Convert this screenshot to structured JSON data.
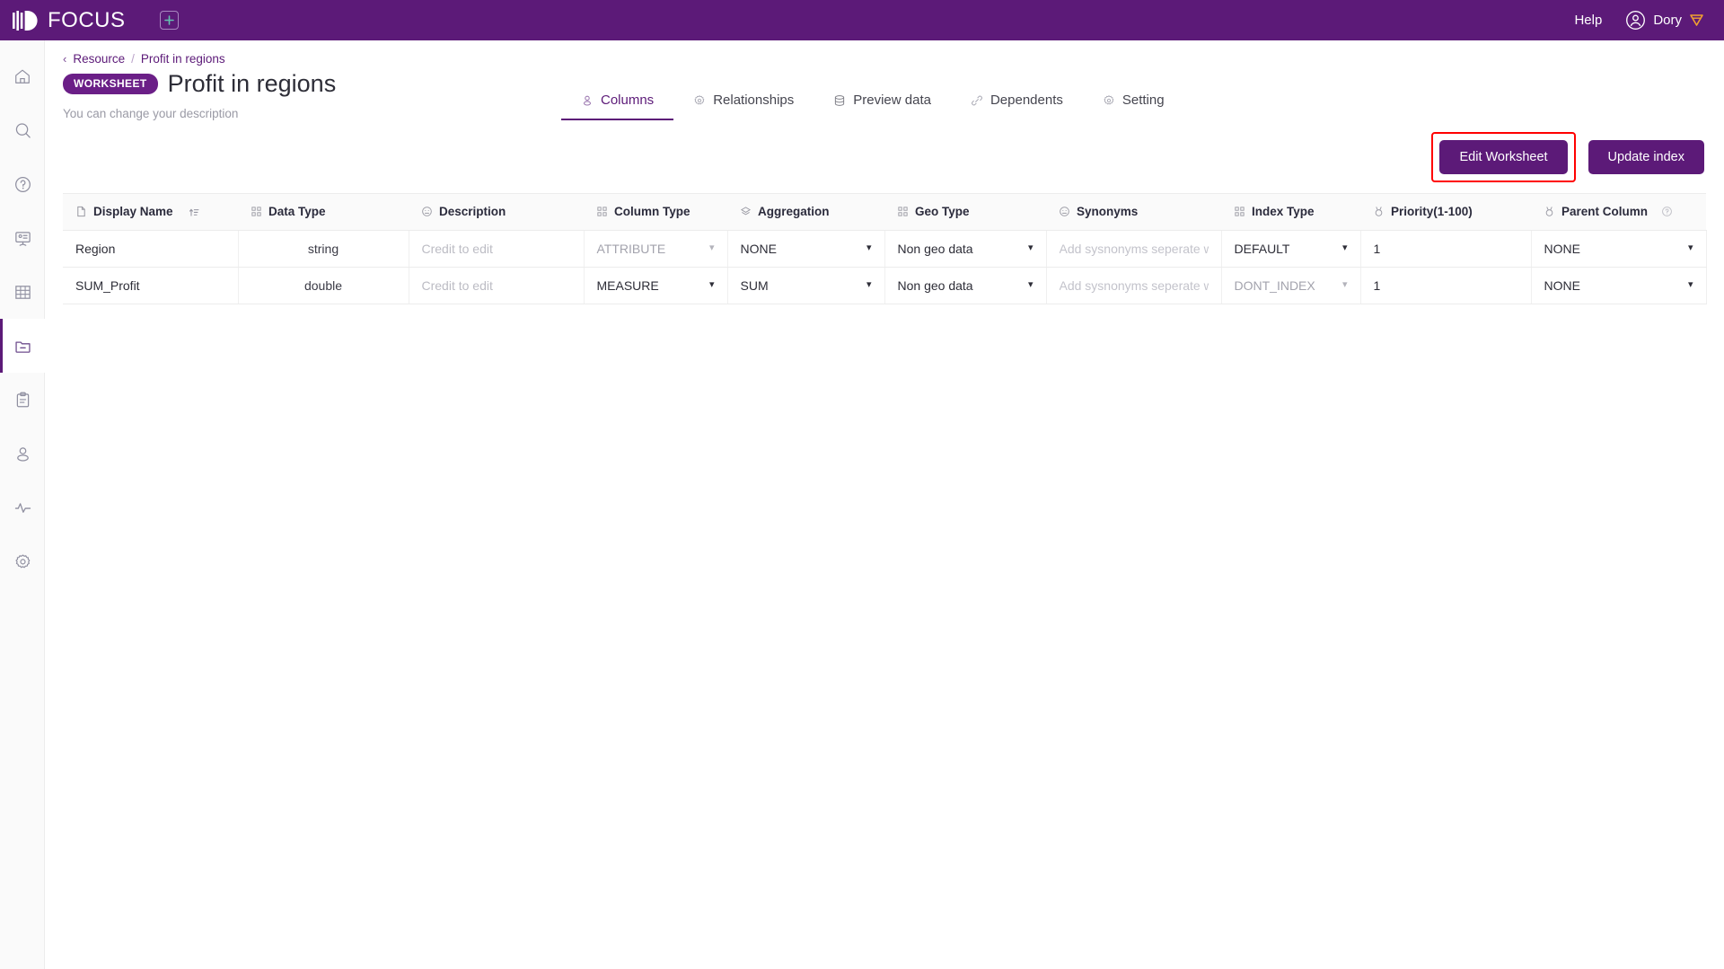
{
  "topbar": {
    "brand": "FOCUS",
    "add_tab_icon": "plus-square-icon",
    "help": "Help",
    "user_name": "Dory",
    "user_icon": "user-circle-icon",
    "badge_icon": "shield-icon",
    "bg": "#5c1a78"
  },
  "sidebar": {
    "items": [
      {
        "name": "home",
        "icon": "home-icon",
        "active": false
      },
      {
        "name": "search",
        "icon": "search-icon",
        "active": false
      },
      {
        "name": "help",
        "icon": "question-circle-icon",
        "active": false
      },
      {
        "name": "presentation",
        "icon": "presentation-icon",
        "active": false
      },
      {
        "name": "tables",
        "icon": "grid-table-icon",
        "active": false
      },
      {
        "name": "worksheets",
        "icon": "folder-minus-icon",
        "active": true
      },
      {
        "name": "tasks",
        "icon": "clipboard-icon",
        "active": false
      },
      {
        "name": "users",
        "icon": "user-icon",
        "active": false
      },
      {
        "name": "monitoring",
        "icon": "activity-pulse-icon",
        "active": false
      },
      {
        "name": "settings",
        "icon": "gear-icon",
        "active": false
      }
    ]
  },
  "breadcrumb": {
    "back_icon": "chevron-left-icon",
    "parent": "Resource",
    "separator": "/",
    "current": "Profit in regions"
  },
  "page": {
    "badge": "WORKSHEET",
    "title": "Profit in regions",
    "description": "You can change your description"
  },
  "tabs": [
    {
      "label": "Columns",
      "icon": "person-outline-icon",
      "active": true
    },
    {
      "label": "Relationships",
      "icon": "gear-outline-icon",
      "active": false
    },
    {
      "label": "Preview data",
      "icon": "database-icon",
      "active": false
    },
    {
      "label": "Dependents",
      "icon": "link-icon",
      "active": false
    },
    {
      "label": "Setting",
      "icon": "gear-outline-icon",
      "active": false
    }
  ],
  "actions": {
    "edit_worksheet": "Edit Worksheet",
    "update_index": "Update index",
    "highlight_color": "#ff0000",
    "button_color": "#5c1a78"
  },
  "table": {
    "columns": [
      {
        "key": "display_name",
        "label": "Display Name",
        "icon": "document-icon",
        "sort_icon": "sort-asc-icon"
      },
      {
        "key": "data_type",
        "label": "Data Type",
        "icon": "blocks-icon"
      },
      {
        "key": "description",
        "label": "Description",
        "icon": "smiley-icon"
      },
      {
        "key": "column_type",
        "label": "Column Type",
        "icon": "blocks-icon"
      },
      {
        "key": "aggregation",
        "label": "Aggregation",
        "icon": "layers-icon"
      },
      {
        "key": "geo_type",
        "label": "Geo Type",
        "icon": "blocks-icon"
      },
      {
        "key": "synonyms",
        "label": "Synonyms",
        "icon": "smiley-icon"
      },
      {
        "key": "index_type",
        "label": "Index Type",
        "icon": "blocks-icon"
      },
      {
        "key": "priority",
        "label": "Priority(1-100)",
        "icon": "medal-icon"
      },
      {
        "key": "parent_column",
        "label": "Parent Column",
        "icon": "medal-icon",
        "help_icon": "question-circle-icon"
      }
    ],
    "synonyms_placeholder": "Add sysnonyms seperate w",
    "description_placeholder": "Credit to edit",
    "rows": [
      {
        "display_name": "Region",
        "data_type": "string",
        "description": "",
        "column_type": "ATTRIBUTE",
        "column_type_dim": true,
        "aggregation": "NONE",
        "aggregation_dim": false,
        "geo_type": "Non geo data",
        "synonyms": "",
        "index_type": "DEFAULT",
        "index_type_dim": false,
        "priority": "1",
        "parent_column": "NONE"
      },
      {
        "display_name": "SUM_Profit",
        "data_type": "double",
        "description": "",
        "column_type": "MEASURE",
        "column_type_dim": false,
        "aggregation": "SUM",
        "aggregation_dim": false,
        "geo_type": "Non geo data",
        "synonyms": "",
        "index_type": "DONT_INDEX",
        "index_type_dim": true,
        "priority": "1",
        "parent_column": "NONE"
      }
    ]
  }
}
